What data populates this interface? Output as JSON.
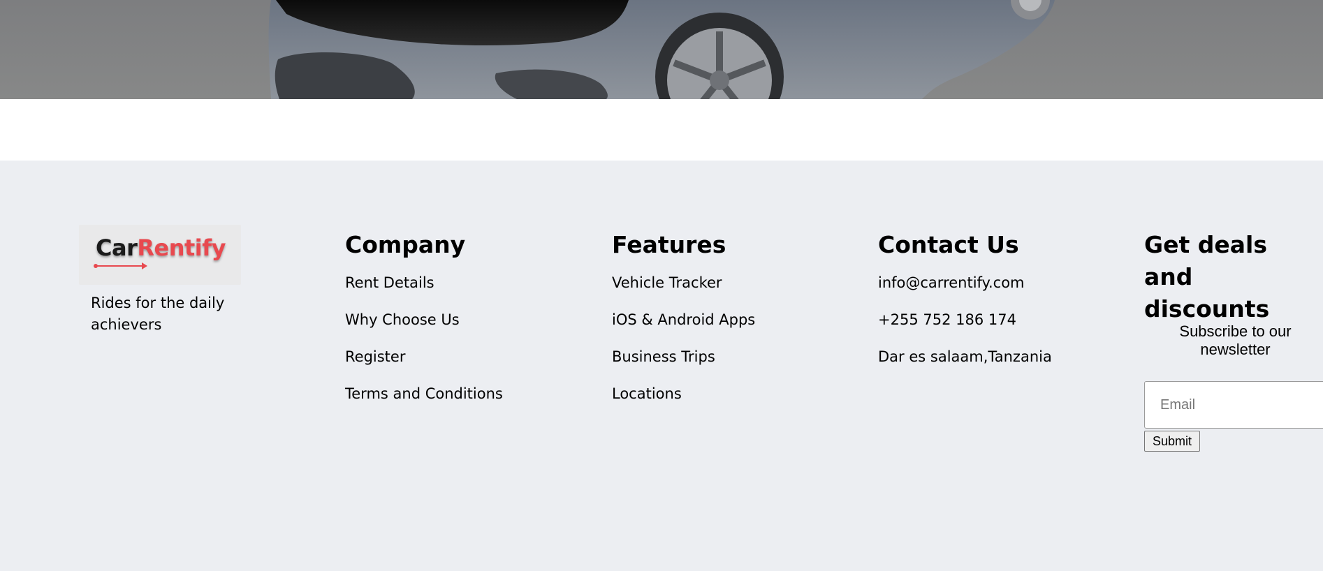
{
  "brand": {
    "name_part1": "Car",
    "name_part2": "Rentify",
    "tagline": "Rides for the daily achievers",
    "colors": {
      "accent": "#e8494f",
      "dark": "#1b1b1b"
    }
  },
  "footer": {
    "background": "#eceef2",
    "company": {
      "heading": "Company",
      "links": [
        "Rent Details",
        "Why Choose Us",
        "Register",
        "Terms and Conditions"
      ]
    },
    "features": {
      "heading": "Features",
      "links": [
        "Vehicle Tracker",
        "iOS & Android Apps",
        "Business Trips",
        "Locations"
      ]
    },
    "contact": {
      "heading": "Contact Us",
      "email": "info@carrentify.com",
      "phone": "+255 752 186 174",
      "address": "Dar es salaam,Tanzania"
    },
    "deals": {
      "heading": "Get deals and discounts",
      "subscribe_text": "Subscribe to our newsletter",
      "email_placeholder": "Email",
      "submit_label": "Submit"
    }
  }
}
